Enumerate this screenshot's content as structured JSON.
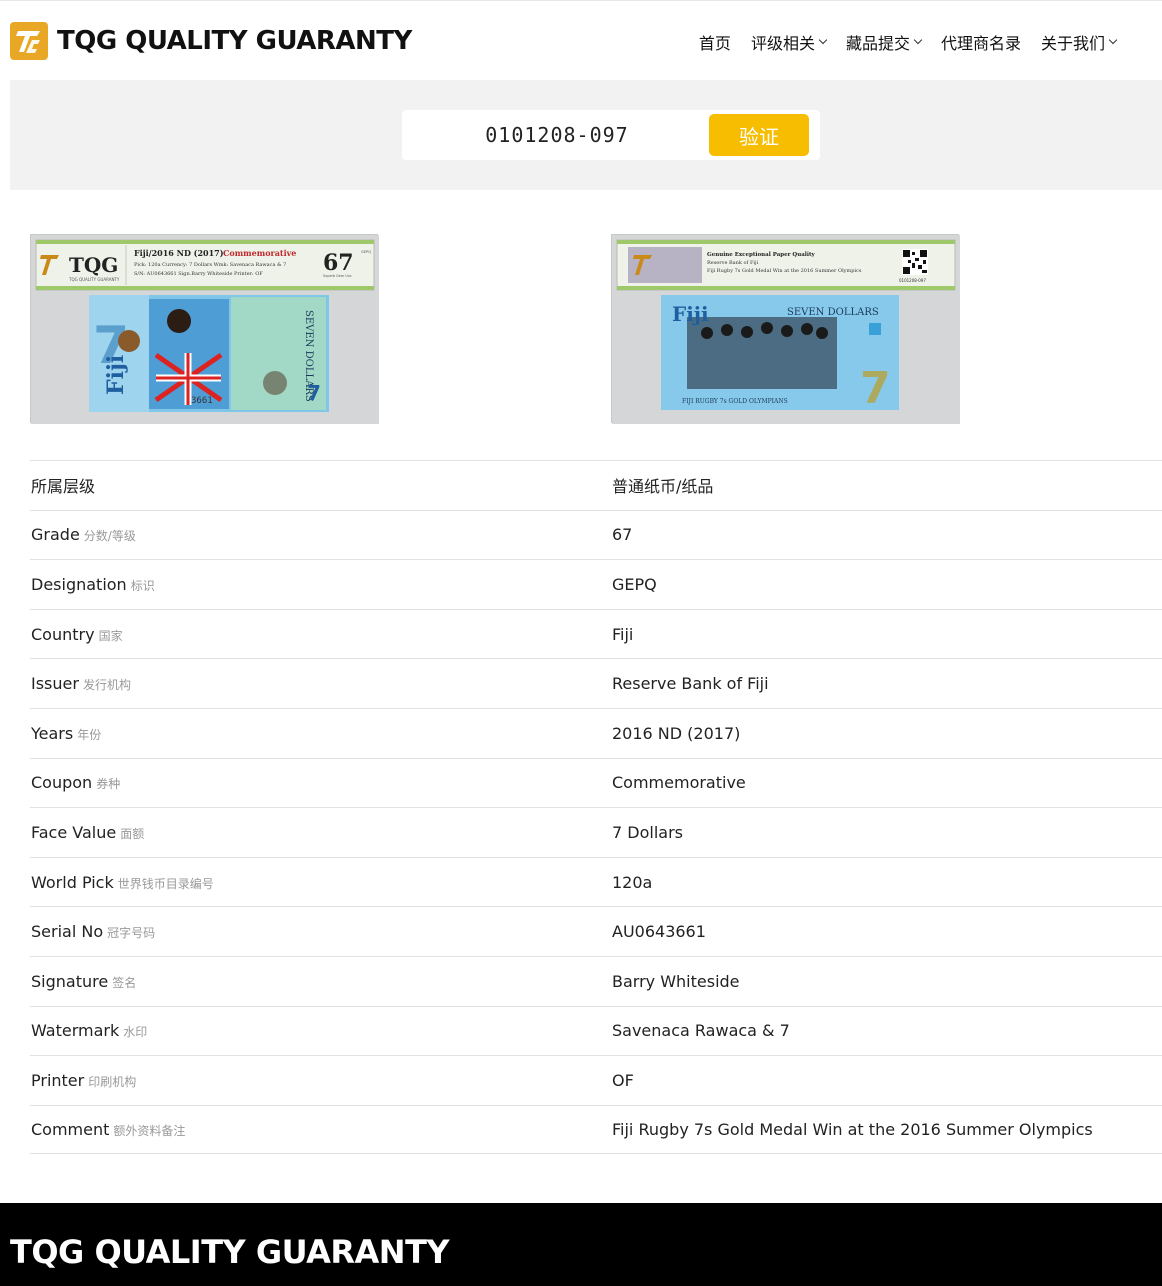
{
  "header": {
    "logo_text": "TQG QUALITY GUARANTY",
    "nav": [
      {
        "label": "首页",
        "has_dropdown": false
      },
      {
        "label": "评级相关",
        "has_dropdown": true
      },
      {
        "label": "藏品提交",
        "has_dropdown": true
      },
      {
        "label": "代理商名录",
        "has_dropdown": false
      },
      {
        "label": "关于我们",
        "has_dropdown": true
      }
    ]
  },
  "search": {
    "value": "0101208-097",
    "button_label": "验证"
  },
  "slab_front": {
    "label_line1": "Fiji/2016 ND (2017)",
    "label_tag": "Commemorative",
    "label_line2": "Pick: 120a     Currency: 7 Dollars     Wmk: Savenaca Rawaca & 7",
    "label_line3": "S/N: AU0643661     Sign.Barry Whiteside     Printer: OF",
    "grade": "67",
    "designation": "GEPQ",
    "grade_caption": "Superb Gem Unc",
    "brand": "TQG",
    "brand_caption": "TQG QUALITY GUARANTY",
    "note_word": "Fiji",
    "note_value": "7",
    "note_text": "SEVEN DOLLARS",
    "serial_fragment": "3661"
  },
  "slab_back": {
    "label_line1": "Genuine Exceptional Paper Quality",
    "label_line2": "Reserve Bank of Fiji",
    "label_line3": "Fiji Rugby 7s Gold Medal Win at the 2016 Summer Olympics",
    "cert_no": "0101208-097",
    "note_word": "Fiji",
    "note_text": "SEVEN DOLLARS",
    "note_value": "7",
    "note_caption": "FIJI RUGBY 7s GOLD OLYMPIANS"
  },
  "details": [
    {
      "label": "所属层级",
      "label_cn": "",
      "value": "普通纸币/纸品"
    },
    {
      "label": "Grade",
      "label_cn": "分数/等级",
      "value": "67"
    },
    {
      "label": "Designation",
      "label_cn": "标识",
      "value": "GEPQ"
    },
    {
      "label": "Country",
      "label_cn": "国家",
      "value": "Fiji"
    },
    {
      "label": "Issuer",
      "label_cn": "发行机构",
      "value": "Reserve Bank of Fiji"
    },
    {
      "label": "Years",
      "label_cn": "年份",
      "value": "2016 ND (2017)"
    },
    {
      "label": "Coupon",
      "label_cn": "券种",
      "value": "Commemorative"
    },
    {
      "label": "Face Value",
      "label_cn": "面额",
      "value": "7 Dollars"
    },
    {
      "label": "World Pick",
      "label_cn": "世界钱币目录编号",
      "value": "120a"
    },
    {
      "label": "Serial No",
      "label_cn": "冠字号码",
      "value": "AU0643661"
    },
    {
      "label": "Signature",
      "label_cn": "签名",
      "value": "Barry Whiteside"
    },
    {
      "label": "Watermark",
      "label_cn": "水印",
      "value": "Savenaca Rawaca & 7"
    },
    {
      "label": "Printer",
      "label_cn": "印刷机构",
      "value": "OF"
    },
    {
      "label": "Comment",
      "label_cn": "额外资料备注",
      "value": "Fiji Rugby 7s Gold Medal Win at the 2016 Summer Olympics"
    }
  ],
  "footer": {
    "title": "TQG QUALITY GUARANTY"
  },
  "colors": {
    "accent": "#f7bd00",
    "logo": "#e8a826",
    "band": "#f2f2f2",
    "footer": "#000000"
  }
}
